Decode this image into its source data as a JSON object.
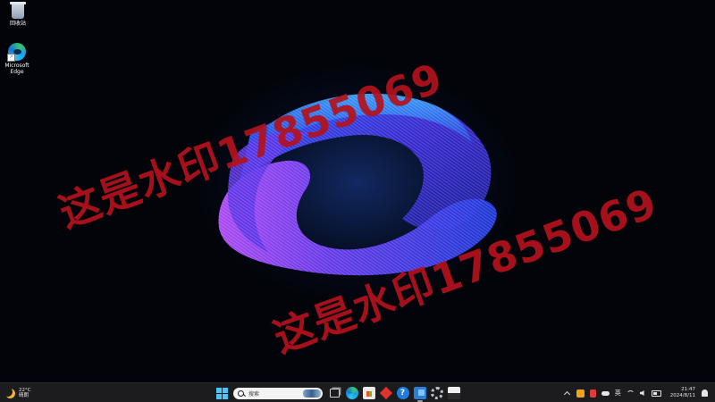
{
  "desktop": {
    "icons": [
      {
        "label": "回收站",
        "icon": "recycle-bin-icon"
      },
      {
        "label": "Microsoft Edge",
        "icon": "edge-icon"
      }
    ],
    "watermark": "这是水印17855069",
    "wallpaper": "windows-11-ribbon-bloom"
  },
  "taskbar": {
    "weather": {
      "temperature": "22°C",
      "condition": "晴朗",
      "icon": "moon-icon"
    },
    "search": {
      "placeholder": "搜索"
    },
    "pinned_apps": [
      "start-icon",
      "search-input",
      "task-view-icon",
      "edge-icon",
      "store-icon",
      "red-diamond-app-icon",
      "help-icon",
      "blue-app-icon",
      "settings-gear-icon",
      "sandbox-app-icon"
    ],
    "tray": {
      "ime": "英",
      "clock_time": "21:47",
      "clock_date": "2024/8/11"
    }
  },
  "colors": {
    "watermark": "#b3121c",
    "taskbar_bg": "#1c1c1e",
    "accent": "#4cc2ff"
  }
}
